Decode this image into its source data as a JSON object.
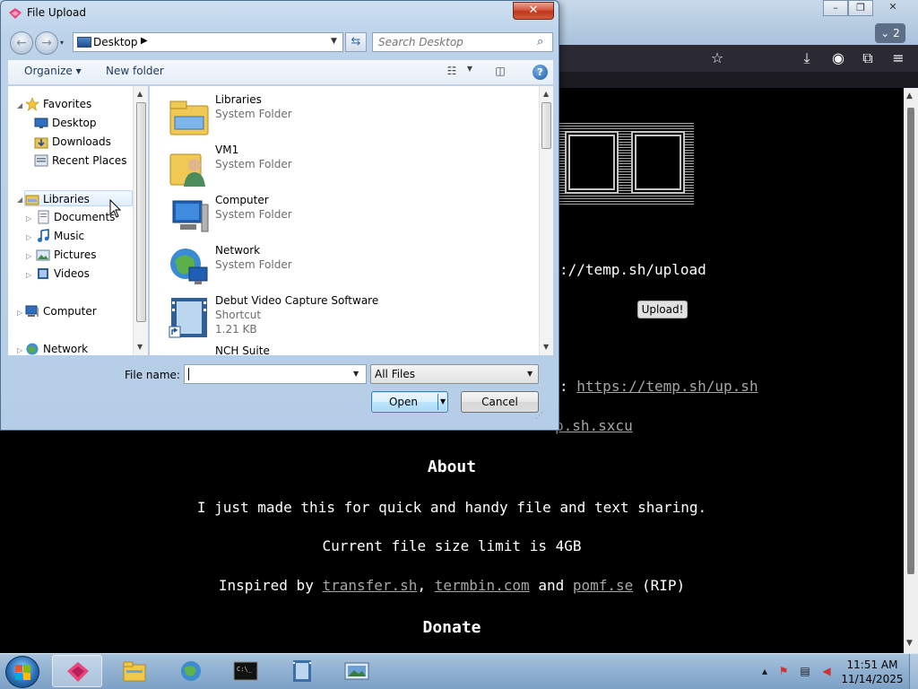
{
  "browser": {
    "tab_count": "2",
    "page": {
      "upload_url_text": "://temp.sh/upload",
      "upload_button": "Upload!",
      "script_prefix": ":",
      "script_link": "https://temp.sh/up.sh",
      "sxcu_link": "p.sh.sxcu",
      "about_heading": "About",
      "about_text": "I just made this for quick and handy file and text sharing.",
      "limit_text": "Current file size limit is 4GB",
      "inspired_prefix": "Inspired by",
      "inspired_link1": "transfer.sh",
      "inspired_comma": ",",
      "inspired_link2": "termbin.com",
      "inspired_and": "and",
      "inspired_link3": "pomf.se",
      "inspired_suffix": "(RIP)",
      "donate_heading": "Donate"
    }
  },
  "dialog": {
    "title": "File Upload",
    "close_label": "✕",
    "address": "Desktop",
    "search_placeholder": "Search Desktop",
    "toolbar": {
      "organize": "Organize",
      "new_folder": "New folder"
    },
    "nav": {
      "favorites": "Favorites",
      "desktop": "Desktop",
      "downloads": "Downloads",
      "recent_places": "Recent Places",
      "libraries": "Libraries",
      "documents": "Documents",
      "music": "Music",
      "pictures": "Pictures",
      "videos": "Videos",
      "computer": "Computer",
      "network": "Network"
    },
    "files": [
      {
        "name": "Libraries",
        "type": "System Folder"
      },
      {
        "name": "VM1",
        "type": "System Folder"
      },
      {
        "name": "Computer",
        "type": "System Folder"
      },
      {
        "name": "Network",
        "type": "System Folder"
      },
      {
        "name": "Debut Video Capture Software",
        "type": "Shortcut",
        "size": "1.21 KB"
      },
      {
        "name": "NCH Suite",
        "type": ""
      }
    ],
    "file_name_label": "File name:",
    "file_name_value": "",
    "file_type": "All Files",
    "open_label": "Open",
    "cancel_label": "Cancel"
  },
  "taskbar": {
    "time": "11:51 AM",
    "date": "11/14/2025"
  },
  "colors": {
    "page_bg": "#000000",
    "link": "#a6a6a6",
    "dialog_frame": "#b5cde6",
    "taskbar": "#8fb0d1"
  }
}
